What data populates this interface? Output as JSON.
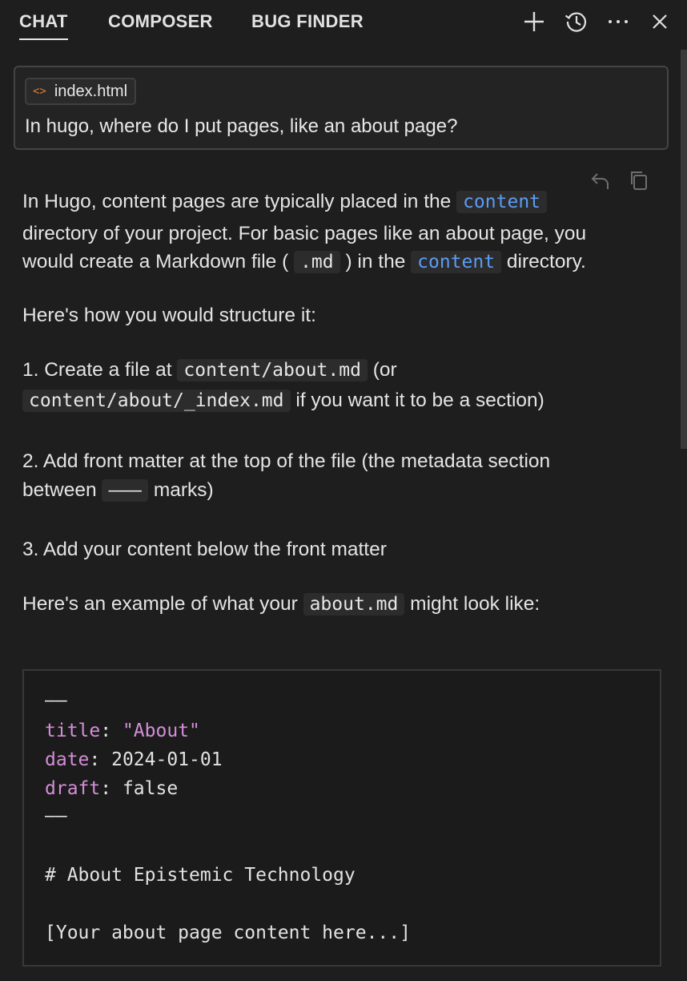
{
  "tabs": [
    {
      "label": "CHAT",
      "active": true
    },
    {
      "label": "COMPOSER",
      "active": false
    },
    {
      "label": "BUG FINDER",
      "active": false
    }
  ],
  "header_icons": [
    "plus-icon",
    "history-icon",
    "more-icon",
    "close-icon"
  ],
  "prompt": {
    "file_chip": "index.html",
    "text": "In hugo, where do I put pages, like an about page?"
  },
  "response": {
    "p1": {
      "a": "In Hugo, content pages are typically placed in the",
      "code1": "content",
      "b": "directory of your project. For basic pages like an about page, you",
      "c": "would create a Markdown file (",
      "code2": ".md",
      "d": ") in the",
      "code3": "content",
      "e": "directory."
    },
    "p2": "Here's how you would structure it:",
    "step1": {
      "a": "1. Create a file at",
      "code1": "content/about.md",
      "b": "(or",
      "code2": "content/about/_index.md",
      "c": "if you want it to be a section)"
    },
    "step2": {
      "a": "2. Add front matter at the top of the file (the metadata section",
      "b": "between",
      "code": "———",
      "c": "marks)"
    },
    "step3": "3. Add your content below the front matter",
    "p3": {
      "a": "Here's an example of what your",
      "code": "about.md",
      "b": "might look like:"
    }
  },
  "code_block": {
    "sep": "——",
    "title_key": "title",
    "title_val": "\"About\"",
    "date_key": "date",
    "date_val": "2024-01-01",
    "draft_key": "draft",
    "draft_val": "false",
    "heading": "# About Epistemic Technology",
    "body": "[Your about page content here...]"
  },
  "colors": {
    "background": "#1e1e1e",
    "code_link_blue": "#5c9cf5",
    "yaml_key": "#d48ed8",
    "file_icon": "#e07a3c"
  }
}
